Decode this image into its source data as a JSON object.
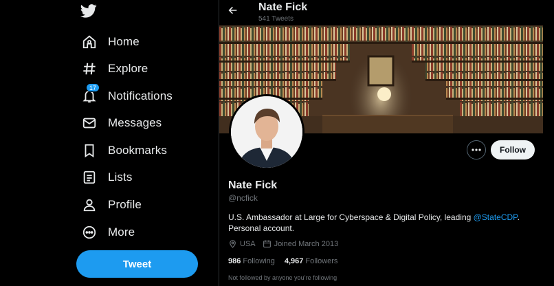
{
  "nav": {
    "items": [
      {
        "label": "Home",
        "icon": "home-icon"
      },
      {
        "label": "Explore",
        "icon": "hashtag-icon"
      },
      {
        "label": "Notifications",
        "icon": "bell-icon",
        "badge": "17"
      },
      {
        "label": "Messages",
        "icon": "envelope-icon"
      },
      {
        "label": "Bookmarks",
        "icon": "bookmark-icon"
      },
      {
        "label": "Lists",
        "icon": "list-icon"
      },
      {
        "label": "Profile",
        "icon": "person-icon"
      },
      {
        "label": "More",
        "icon": "more-circle-icon"
      }
    ],
    "tweet_button": "Tweet"
  },
  "header": {
    "name": "Nate Fick",
    "tweet_count": "541 Tweets"
  },
  "profile": {
    "name": "Nate Fick",
    "handle": "@ncfick",
    "bio_text": "U.S. Ambassador at Large for Cyberspace & Digital Policy, leading ",
    "bio_link": "@StateCDP",
    "bio_end": ".",
    "bio_line2": "Personal account.",
    "location": "USA",
    "joined": "Joined March 2013",
    "following_count": "986",
    "following_label": "Following",
    "followers_count": "4,967",
    "followers_label": "Followers",
    "not_followed": "Not followed by anyone you’re following",
    "follow_button": "Follow"
  },
  "colors": {
    "accent": "#1d9bf0",
    "background": "#000000",
    "text": "#e7e9ea",
    "muted": "#71767b"
  }
}
